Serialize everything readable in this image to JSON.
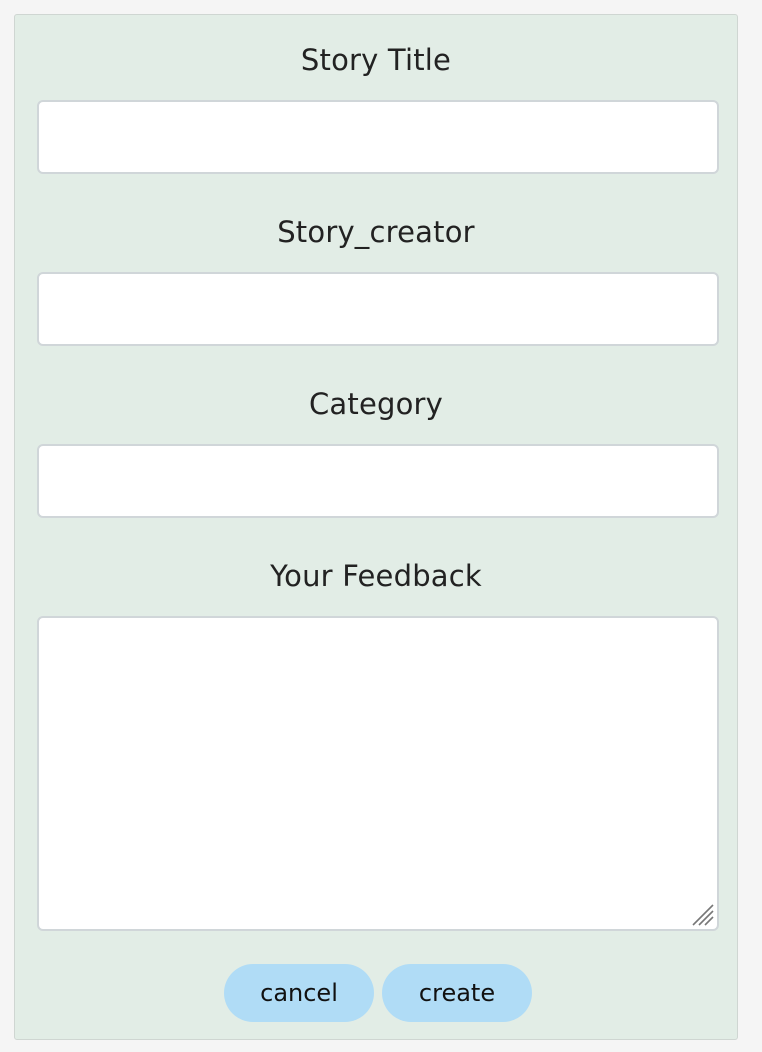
{
  "form": {
    "fields": [
      {
        "label": "Story Title",
        "value": "",
        "placeholder": ""
      },
      {
        "label": "Story_creator",
        "value": "",
        "placeholder": ""
      },
      {
        "label": "Category",
        "value": "",
        "placeholder": ""
      }
    ],
    "feedback": {
      "label": "Your Feedback",
      "value": "",
      "placeholder": ""
    },
    "buttons": {
      "cancel_label": "cancel",
      "create_label": "create"
    }
  },
  "colors": {
    "panel_background": "#e2ede6",
    "button_background": "#b0dcf6",
    "page_background": "#f5f5f5"
  }
}
